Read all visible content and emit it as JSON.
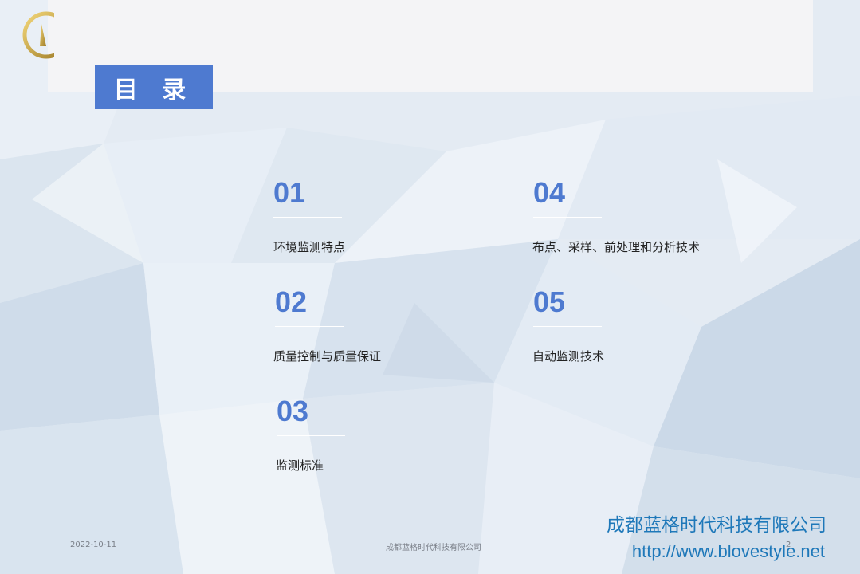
{
  "slide": {
    "toc_title": "目 录",
    "items": [
      {
        "num": "01",
        "label": "环境监测特点"
      },
      {
        "num": "02",
        "label": "质量控制与质量保证"
      },
      {
        "num": "03",
        "label": "监测标准"
      },
      {
        "num": "04",
        "label": "布点、采样、前处理和分析技术"
      },
      {
        "num": "05",
        "label": "自动监测技术"
      }
    ]
  },
  "footer": {
    "date": "2022-10-11",
    "center": "成都蓝格时代科技有限公司",
    "page": "2"
  },
  "branding": {
    "company": "成都蓝格时代科技有限公司",
    "url": "http://www.blovestyle.net",
    "logo_icon": "gold-logo-icon"
  },
  "colors": {
    "accent": "#4e7ad0",
    "brand_text": "#1e78b9",
    "panel": "#f4f4f6"
  }
}
